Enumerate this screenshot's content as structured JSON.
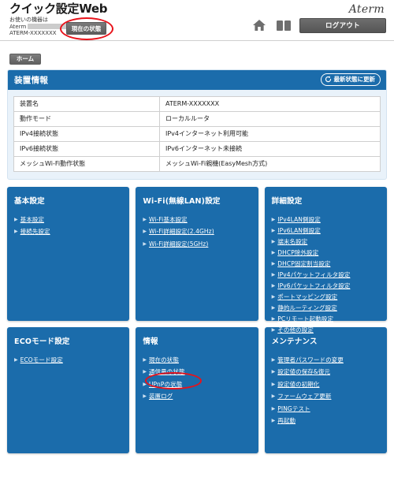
{
  "header": {
    "brand_title": "クイック設定Web",
    "sub_line1": "お使いの機器は",
    "sub_line2_prefix": "Aterm",
    "sub_line3": "ATERM-XXXXXXX",
    "aterm_logo": "Aterm",
    "state_button": "現在の状態",
    "logout_button": "ログアウト",
    "home_icon": "home-icon",
    "manual_icon": "book-icon"
  },
  "breadcrumb": {
    "home_label": "ホーム"
  },
  "device_info": {
    "title": "装置情報",
    "refresh_label": "最新状態に更新",
    "refresh_icon": "refresh-icon",
    "rows": [
      {
        "key": "装置名",
        "value": "ATERM-XXXXXXX"
      },
      {
        "key": "動作モード",
        "value": "ローカルルータ"
      },
      {
        "key": "IPv4接続状態",
        "value": "IPv4インターネット利用可能"
      },
      {
        "key": "IPv6接続状態",
        "value": "IPv6インターネット未接続"
      },
      {
        "key": "メッシュWi-Fi動作状態",
        "value": "メッシュWi-Fi親機(EasyMesh方式)"
      }
    ]
  },
  "menu": {
    "panels": [
      {
        "title": "基本設定",
        "items": [
          "基本設定",
          "接続先設定"
        ]
      },
      {
        "title": "Wi-Fi(無線LAN)設定",
        "items": [
          "Wi-Fi基本設定",
          "Wi-Fi詳細設定(2.4GHz)",
          "Wi-Fi詳細設定(5GHz)"
        ]
      },
      {
        "title": "詳細設定",
        "items": [
          "IPv4LAN側設定",
          "IPv6LAN側設定",
          "端末名設定",
          "DHCP除外設定",
          "DHCP固定割当設定",
          "IPv4パケットフィルタ設定",
          "IPv6パケットフィルタ設定",
          "ポートマッピング設定",
          "静的ルーティング設定",
          "PCリモート起動設定",
          "その他の設定"
        ]
      },
      {
        "title": "ECOモード設定",
        "items": [
          "ECOモード設定"
        ]
      },
      {
        "title": "情報",
        "items": [
          "現在の状態",
          "通信量の状態",
          "UPnPの状態",
          "装置ログ"
        ]
      },
      {
        "title": "メンテナンス",
        "items": [
          "管理者パスワードの変更",
          "設定値の保存&復元",
          "設定値の初期化",
          "ファームウェア更新",
          "PINGテスト",
          "再起動"
        ]
      }
    ]
  },
  "colors": {
    "panel_blue": "#1b6cab",
    "card_light_blue": "#e9f2fa",
    "annotation_red": "#e8121a",
    "button_grey": "#606060"
  }
}
